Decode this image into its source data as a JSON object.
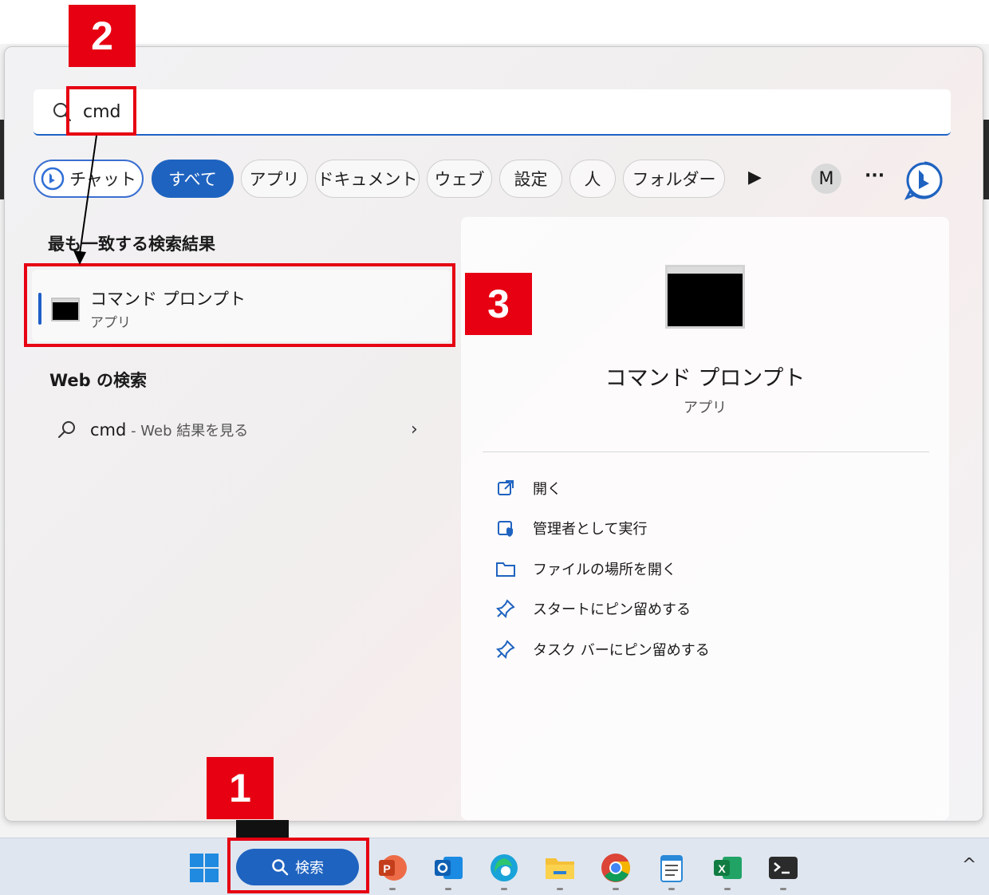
{
  "search": {
    "query": "cmd"
  },
  "filters": [
    {
      "label": "チャット"
    },
    {
      "label": "すべて"
    },
    {
      "label": "アプリ"
    },
    {
      "label": "ドキュメント"
    },
    {
      "label": "ウェブ"
    },
    {
      "label": "設定"
    },
    {
      "label": "人"
    },
    {
      "label": "フォルダー"
    }
  ],
  "toolbar": {
    "play_glyph": "▶",
    "account_initial": "M",
    "more_glyph": "···"
  },
  "best_match": {
    "section_title": "最も一致する検索結果",
    "name": "コマンド プロンプト",
    "type": "アプリ"
  },
  "web_search": {
    "section_title": "Web の検索",
    "query": "cmd",
    "suffix": " - Web 結果を見る",
    "chevron": "›"
  },
  "detail": {
    "title": "コマンド プロンプト",
    "type": "アプリ",
    "actions": [
      {
        "label": "開く",
        "icon": "open-external-icon"
      },
      {
        "label": "管理者として実行",
        "icon": "shield-admin-icon"
      },
      {
        "label": "ファイルの場所を開く",
        "icon": "folder-icon"
      },
      {
        "label": "スタートにピン留めする",
        "icon": "pin-icon"
      },
      {
        "label": "タスク バーにピン留めする",
        "icon": "pin-icon"
      }
    ]
  },
  "taskbar": {
    "search_label": "検索",
    "tray_chevron": "^",
    "apps": [
      "windows-start-icon",
      "powerpoint-icon",
      "outlook-icon",
      "edge-icon",
      "file-explorer-icon",
      "chrome-icon",
      "notepad-icon",
      "excel-icon",
      "terminal-icon"
    ]
  },
  "annotations": {
    "badge_1": "1",
    "badge_2": "2",
    "badge_3": "3",
    "color": "#e60012"
  },
  "colors": {
    "accent": "#1f63c0",
    "annotation": "#e60012"
  }
}
